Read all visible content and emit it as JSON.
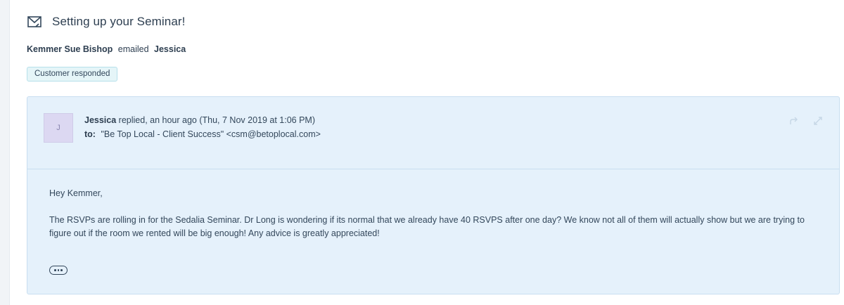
{
  "email": {
    "title": "Setting up your Seminar!",
    "sender_name": "Kemmer Sue Bishop",
    "action_text": "emailed",
    "recipient_name": "Jessica",
    "status_badge": "Customer responded"
  },
  "message": {
    "avatar_initial": "J",
    "author": "Jessica",
    "replied_text": "replied, an hour ago (Thu, 7 Nov 2019 at 1:06 PM)",
    "to_label": "to:",
    "to_value": "\"Be Top Local - Client Success\" <csm@betoplocal.com>",
    "greeting": "Hey Kemmer,",
    "body": "The RSVPs are rolling in for the Sedalia Seminar. Dr Long is wondering if its normal that we already have 40 RSVPS after one day? We know not all of them will actually show but we are trying to figure out if the room we rented will be big enough! Any advice is greatly appreciated!"
  },
  "icons": {
    "header_icon": "email-icon",
    "forward_icon": "forward-icon",
    "expand_icon": "expand-icon",
    "more_icon": "ellipsis-icon"
  },
  "colors": {
    "card_background": "#e5f1fb",
    "badge_background": "#e5f5f8",
    "text": "#33475b"
  }
}
